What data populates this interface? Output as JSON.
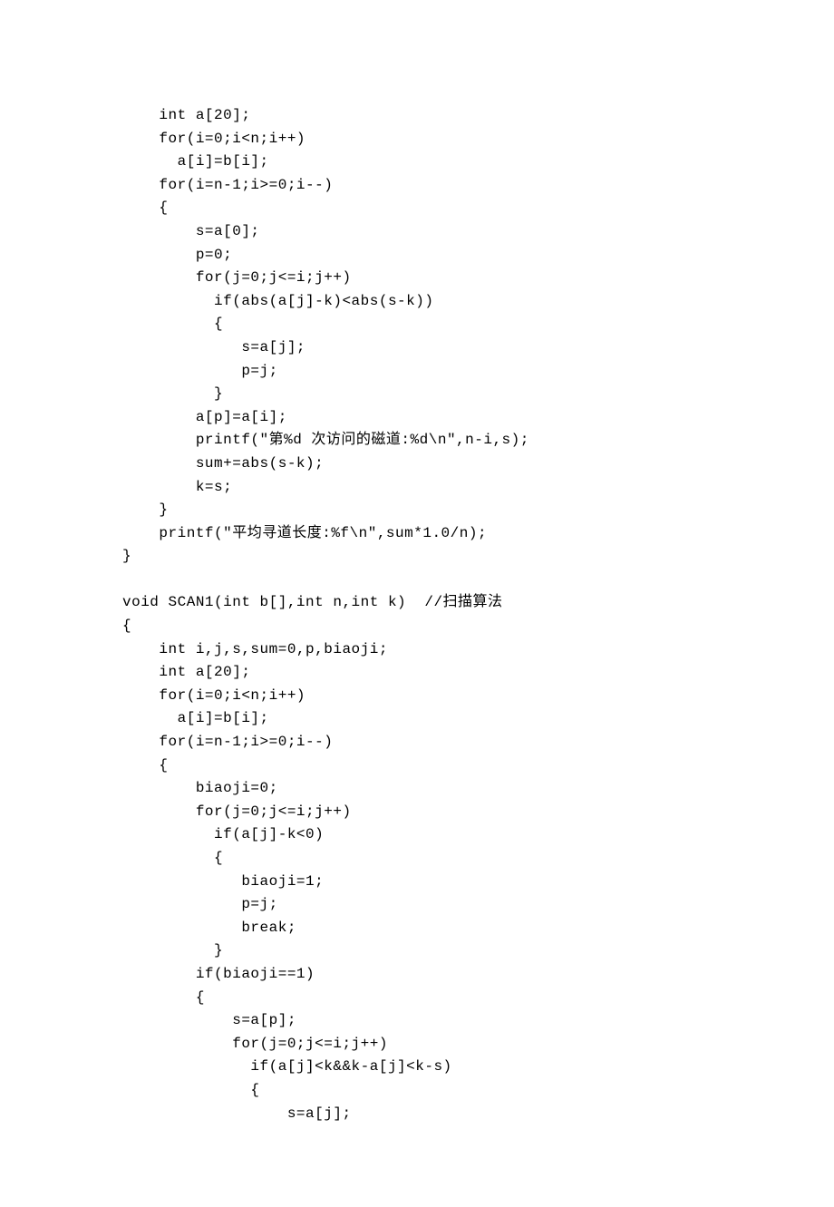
{
  "code": "    int a[20];\n    for(i=0;i<n;i++)\n      a[i]=b[i];\n    for(i=n-1;i>=0;i--)\n    {\n        s=a[0];\n        p=0;\n        for(j=0;j<=i;j++)\n          if(abs(a[j]-k)<abs(s-k))\n          {\n             s=a[j];\n             p=j;\n          }\n        a[p]=a[i];\n        printf(\"第%d 次访问的磁道:%d\\n\",n-i,s);\n        sum+=abs(s-k);\n        k=s;\n    }\n    printf(\"平均寻道长度:%f\\n\",sum*1.0/n);\n}\n\nvoid SCAN1(int b[],int n,int k)  //扫描算法\n{\n    int i,j,s,sum=0,p,biaoji;\n    int a[20];\n    for(i=0;i<n;i++)\n      a[i]=b[i];\n    for(i=n-1;i>=0;i--)\n    {\n        biaoji=0;\n        for(j=0;j<=i;j++)\n          if(a[j]-k<0)\n          {\n             biaoji=1;\n             p=j;\n             break;\n          }\n        if(biaoji==1)\n        {\n            s=a[p];\n            for(j=0;j<=i;j++)\n              if(a[j]<k&&k-a[j]<k-s)\n              {\n                  s=a[j];"
}
